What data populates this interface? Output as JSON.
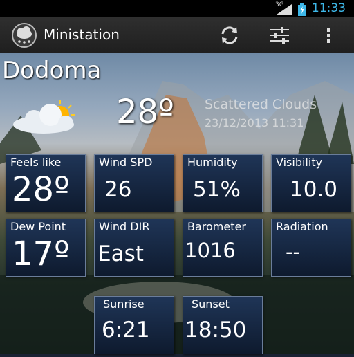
{
  "status_bar": {
    "network": "3G",
    "time": "11:33"
  },
  "app_bar": {
    "title": "Ministation"
  },
  "header": {
    "city": "Dodoma",
    "temperature": "28º",
    "condition": "Scattered Clouds",
    "datetime": "23/12/2013 11:31"
  },
  "tiles": {
    "feels_like": {
      "label": "Feels like",
      "value": "28º"
    },
    "wind_spd": {
      "label": "Wind SPD",
      "value": "26"
    },
    "humidity": {
      "label": "Humidity",
      "value": "51%"
    },
    "visibility": {
      "label": "Visibility",
      "value": "10.0"
    },
    "dew_point": {
      "label": "Dew Point",
      "value": "17º"
    },
    "wind_dir": {
      "label": "Wind DIR",
      "value": "East"
    },
    "barometer": {
      "label": "Barometer",
      "value": "1016"
    },
    "radiation": {
      "label": "Radiation",
      "value": "--"
    },
    "sunrise": {
      "label": "Sunrise",
      "value": "6:21"
    },
    "sunset": {
      "label": "Sunset",
      "value": "18:50"
    }
  },
  "colors": {
    "clock": "#3db7e8",
    "tile_top": "#1f3557",
    "tile_bottom": "#0e1a2e"
  },
  "icons": [
    "app-cloud-icon",
    "refresh-icon",
    "sliders-icon",
    "overflow-menu-icon",
    "partly-cloudy-icon"
  ]
}
